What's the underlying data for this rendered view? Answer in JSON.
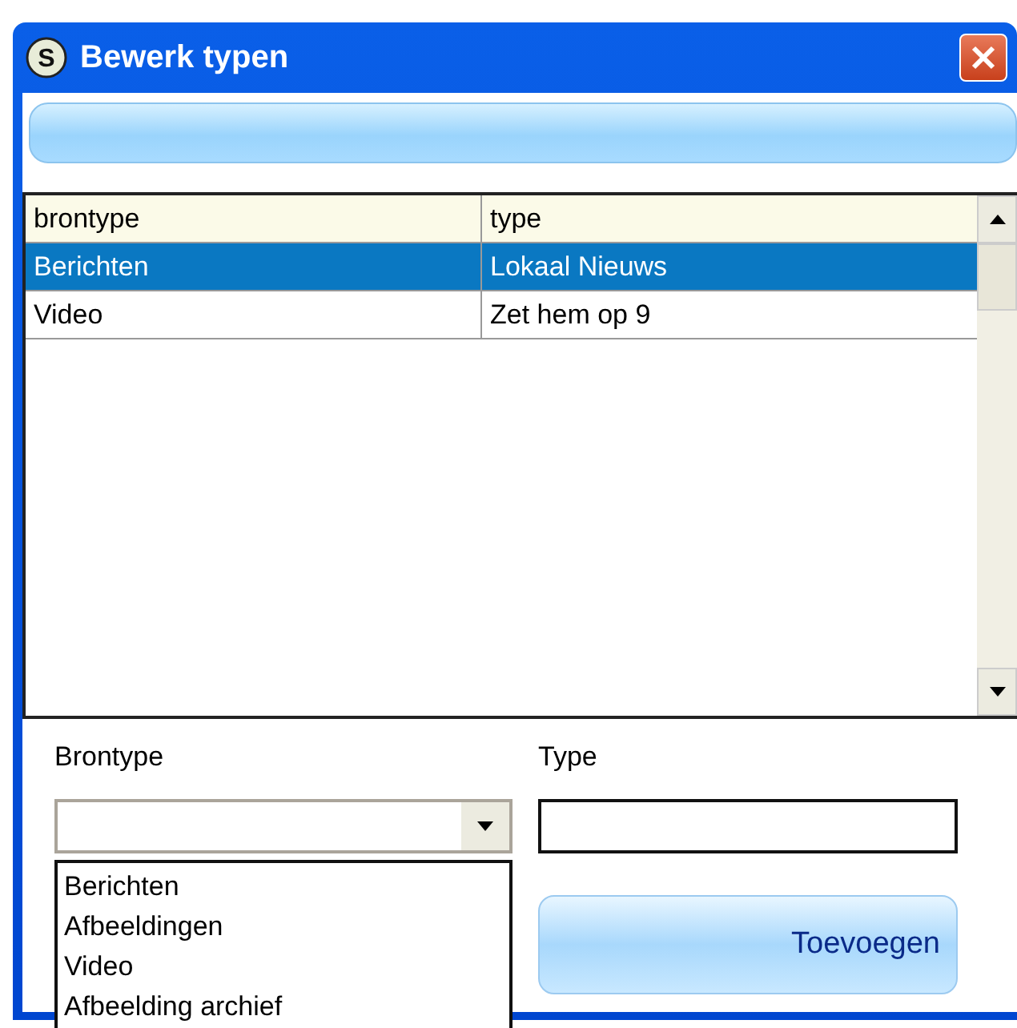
{
  "window": {
    "icon_letter": "S",
    "title": "Bewerk typen"
  },
  "table": {
    "columns": [
      "brontype",
      "type"
    ],
    "rows": [
      {
        "cells": [
          "Berichten",
          "Lokaal Nieuws"
        ],
        "selected": true
      },
      {
        "cells": [
          "Video",
          "Zet hem op 9"
        ],
        "selected": false
      }
    ]
  },
  "form": {
    "brontype_label": "Brontype",
    "type_label": "Type",
    "dropdown_options": [
      "Berichten",
      "Afbeeldingen",
      "Video",
      "Afbeelding archief"
    ],
    "button": "Toevoegen"
  }
}
